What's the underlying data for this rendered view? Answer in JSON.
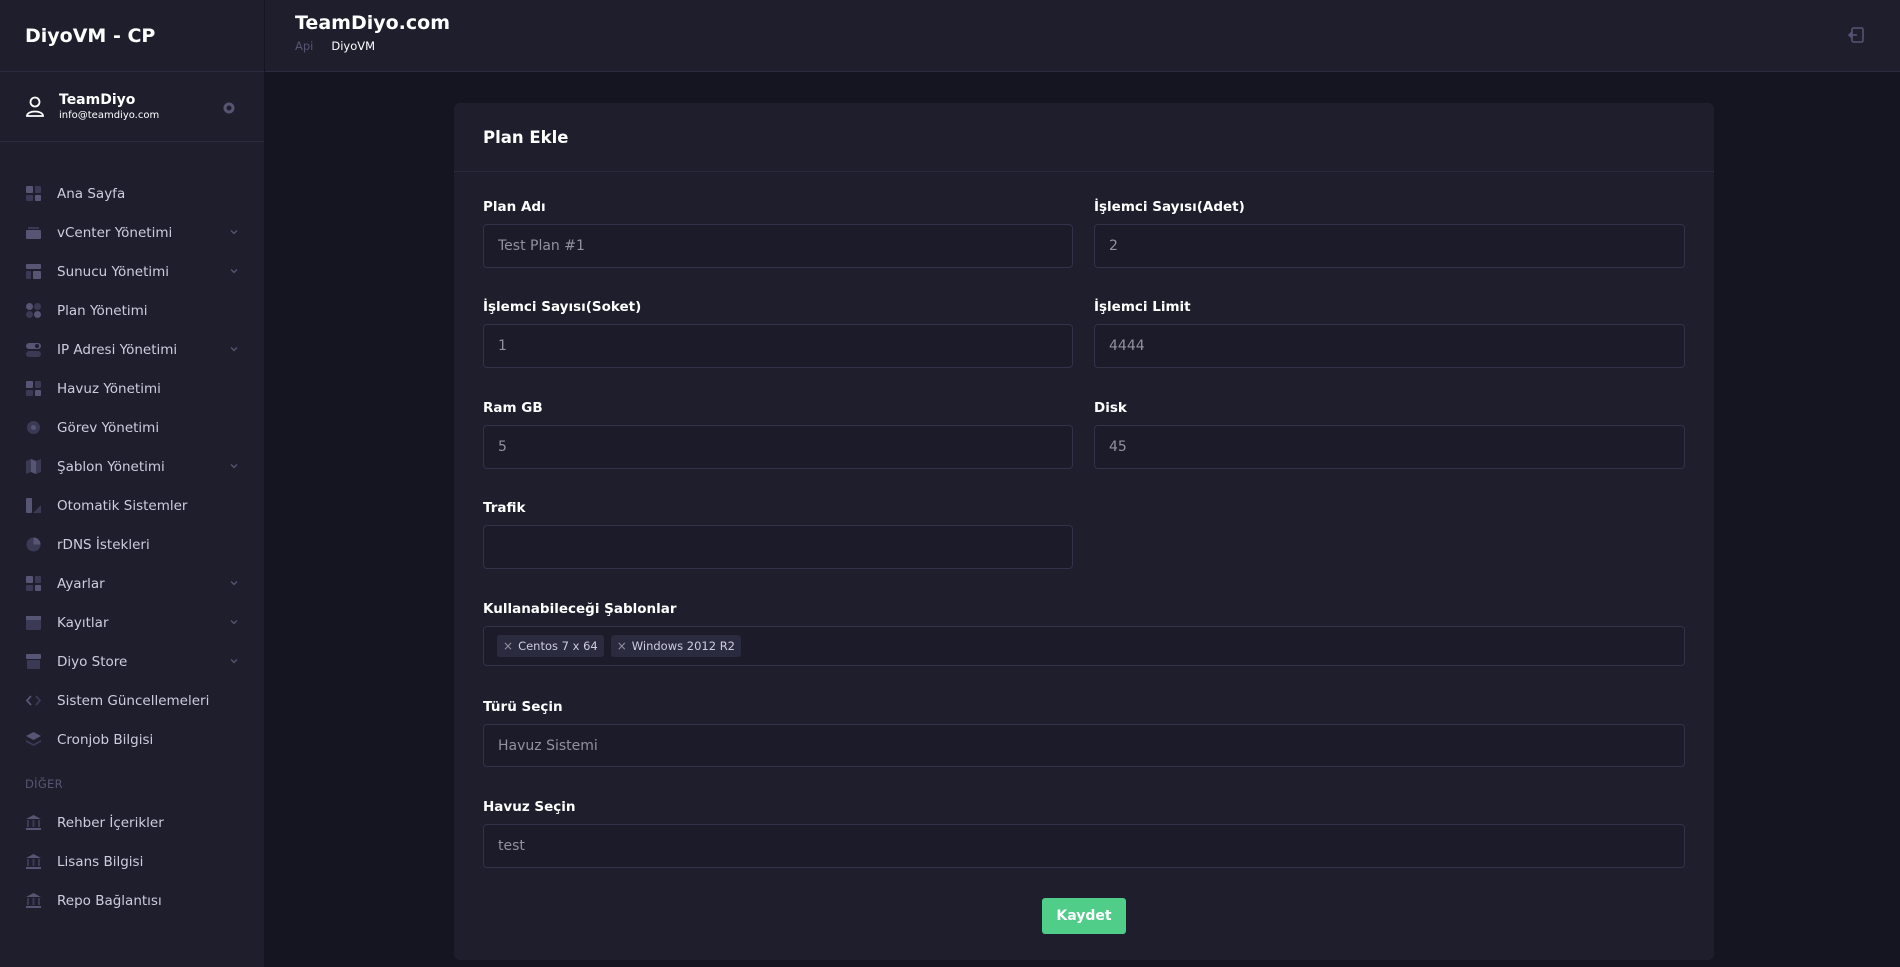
{
  "app": {
    "brand": "DiyoVM - CP"
  },
  "user": {
    "name": "TeamDiyo",
    "email": "info@teamdiyo.com"
  },
  "sidebar": {
    "items": [
      {
        "label": "Ana Sayfa",
        "icon": "grid-icon",
        "has_children": false
      },
      {
        "label": "vCenter Yönetimi",
        "icon": "basket-icon",
        "has_children": true
      },
      {
        "label": "Sunucu Yönetimi",
        "icon": "layout-icon",
        "has_children": true
      },
      {
        "label": "Plan Yönetimi",
        "icon": "dots-icon",
        "has_children": false
      },
      {
        "label": "IP Adresi Yönetimi",
        "icon": "toggle-icon",
        "has_children": true
      },
      {
        "label": "Havuz Yönetimi",
        "icon": "grid-icon",
        "has_children": false
      },
      {
        "label": "Görev Yönetimi",
        "icon": "target-icon",
        "has_children": false
      },
      {
        "label": "Şablon Yönetimi",
        "icon": "map-icon",
        "has_children": true
      },
      {
        "label": "Otomatik Sistemler",
        "icon": "design-icon",
        "has_children": false
      },
      {
        "label": "rDNS İstekleri",
        "icon": "pie-icon",
        "has_children": false
      },
      {
        "label": "Ayarlar",
        "icon": "grid-icon",
        "has_children": true
      },
      {
        "label": "Kayıtlar",
        "icon": "calendar-icon",
        "has_children": true
      },
      {
        "label": "Diyo Store",
        "icon": "store-icon",
        "has_children": true
      },
      {
        "label": "Sistem Güncellemeleri",
        "icon": "code-icon",
        "has_children": false
      },
      {
        "label": "Cronjob Bilgisi",
        "icon": "layers-icon",
        "has_children": false
      }
    ],
    "section_label": "DİĞER",
    "other_items": [
      {
        "label": "Rehber İçerikler",
        "icon": "bank-icon"
      },
      {
        "label": "Lisans Bilgisi",
        "icon": "bank-icon"
      },
      {
        "label": "Repo Bağlantısı",
        "icon": "bank-icon"
      }
    ]
  },
  "header": {
    "title": "TeamDiyo.com",
    "breadcrumb": [
      "Api",
      "DiyoVM"
    ]
  },
  "card": {
    "title": "Plan Ekle",
    "fields": {
      "plan_name": {
        "label": "Plan Adı",
        "value": "Test Plan #1"
      },
      "cpu_count": {
        "label": "İşlemci Sayısı(Adet)",
        "value": "2"
      },
      "cpu_socket": {
        "label": "İşlemci Sayısı(Soket)",
        "value": "1"
      },
      "cpu_limit": {
        "label": "İşlemci Limit",
        "value": "4444"
      },
      "ram": {
        "label": "Ram GB",
        "value": "5"
      },
      "disk": {
        "label": "Disk",
        "value": "45"
      },
      "traffic": {
        "label": "Trafik",
        "value": ""
      },
      "templates": {
        "label": "Kullanabileceği Şablonlar",
        "tags": [
          "Centos 7 x 64",
          "Windows 2012 R2"
        ]
      },
      "type": {
        "label": "Türü Seçin",
        "value": "Havuz Sistemi"
      },
      "pool": {
        "label": "Havuz Seçin",
        "value": "test"
      }
    },
    "save_label": "Kaydet"
  },
  "colors": {
    "background": "#151521",
    "panel": "#1e1e2d",
    "success": "#50cd89",
    "muted": "#565674"
  }
}
